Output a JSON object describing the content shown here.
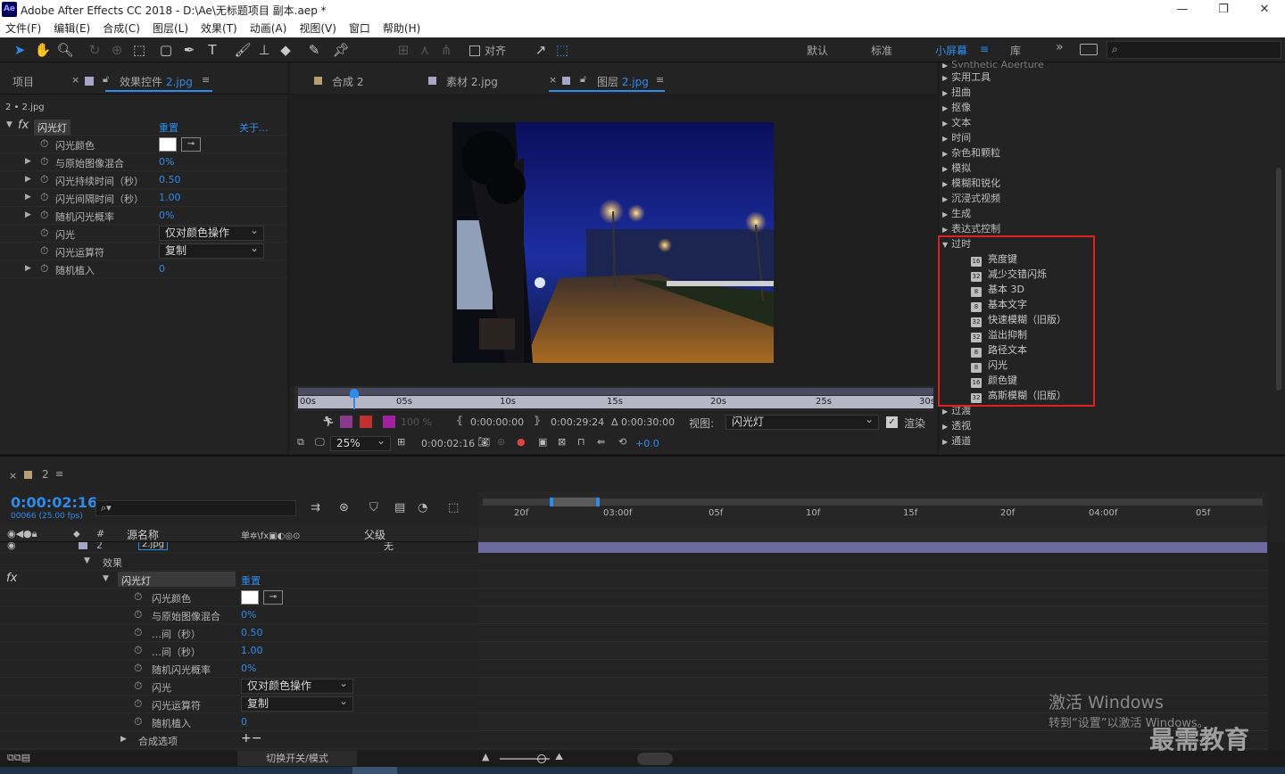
{
  "app": {
    "logo": "Ae",
    "title": "Adobe After Effects CC 2018 - D:\\Ae\\无标题项目 副本.aep *",
    "minimize": "—",
    "maximize": "❐",
    "close": "✕"
  },
  "menu": [
    "文件(F)",
    "编辑(E)",
    "合成(C)",
    "图层(L)",
    "效果(T)",
    "动画(A)",
    "视图(V)",
    "窗口",
    "帮助(H)"
  ],
  "toolbar": {
    "snap_label": "对齐",
    "workspaces": [
      "默认",
      "标准",
      "小屏幕",
      "库"
    ],
    "active_workspace": "小屏幕",
    "more": "»"
  },
  "left_panel": {
    "tab_project": "项目",
    "tab_effects": "效果控件",
    "tab_effects_layer": "2.jpg",
    "breadcrumb": "2 • 2.jpg",
    "effect_name": "闪光灯",
    "reset": "重置",
    "about": "关于...",
    "props": [
      {
        "label": "闪光颜色",
        "value": "",
        "kind": "color"
      },
      {
        "label": "与原始图像混合",
        "value": "0%"
      },
      {
        "label": "闪光持续时间（秒）",
        "value": "0.50"
      },
      {
        "label": "闪光间隔时间（秒）",
        "value": "1.00"
      },
      {
        "label": "随机闪光概率",
        "value": "0%"
      },
      {
        "label": "闪光",
        "value": "仅对颜色操作",
        "kind": "select"
      },
      {
        "label": "闪光运算符",
        "value": "复制",
        "kind": "select"
      },
      {
        "label": "随机植入",
        "value": "0"
      }
    ]
  },
  "viewer": {
    "tabs": [
      {
        "label": "合成",
        "sub": "2"
      },
      {
        "label": "素材",
        "sub": "2.jpg"
      },
      {
        "label": "图层",
        "sub": "2.jpg"
      }
    ],
    "ruler": [
      "00s",
      "05s",
      "10s",
      "15s",
      "20s",
      "25s",
      "30s"
    ],
    "in_time": "0:00:00:00",
    "out_time": "0:00:29:24",
    "duration": "Δ 0:00:30:00",
    "view_label": "视图:",
    "view_value": "闪光灯",
    "render_label": "渲染",
    "zoom_pct": "100 %",
    "zoom": "25%",
    "current_time": "0:00:02:16",
    "exposure": "+0.0"
  },
  "effects_list": {
    "top_partial": "Synthetic Aperture",
    "categories": [
      "实用工具",
      "扭曲",
      "抠像",
      "文本",
      "时间",
      "杂色和颗粒",
      "模拟",
      "模糊和锐化",
      "沉浸式视频",
      "生成",
      "表达式控制"
    ],
    "expanded": "过时",
    "expanded_items": [
      {
        "bit": "16",
        "label": "亮度键"
      },
      {
        "bit": "32",
        "label": "减少交错闪烁"
      },
      {
        "bit": "8",
        "label": "基本 3D"
      },
      {
        "bit": "8",
        "label": "基本文字"
      },
      {
        "bit": "32",
        "label": "快速模糊（旧版）"
      },
      {
        "bit": "32",
        "label": "溢出抑制"
      },
      {
        "bit": "8",
        "label": "路径文本"
      },
      {
        "bit": "8",
        "label": "闪光"
      },
      {
        "bit": "16",
        "label": "颜色键"
      },
      {
        "bit": "32",
        "label": "高斯模糊（旧版）"
      }
    ],
    "after": [
      "过渡",
      "透视",
      "通道"
    ],
    "highlight_color": "#e02020"
  },
  "timeline": {
    "comp_tab": "2",
    "timecode": "0:00:02:16",
    "fps": "00066 (25.00 fps)",
    "search_placeholder": "",
    "col_source": "源名称",
    "col_parent": "父级",
    "col_switches": "单✲\\fx▣◐◎⊙",
    "layer_num": "2",
    "layer_name": "2.jpg",
    "parent_value": "无",
    "effects_group": "效果",
    "effect_name": "闪光灯",
    "reset": "重置",
    "props": [
      {
        "label": "闪光颜色",
        "value": "",
        "kind": "color"
      },
      {
        "label": "与原始图像混合",
        "value": "0%"
      },
      {
        "label": "…间（秒）",
        "value": "0.50"
      },
      {
        "label": "…间（秒）",
        "value": "1.00"
      },
      {
        "label": "随机闪光概率",
        "value": "0%"
      },
      {
        "label": "闪光",
        "value": "仅对颜色操作",
        "kind": "select"
      },
      {
        "label": "闪光运算符",
        "value": "复制",
        "kind": "select"
      },
      {
        "label": "随机植入",
        "value": "0"
      }
    ],
    "comp_options": "合成选项",
    "comp_options_btns": "+−",
    "ruler": [
      "20f",
      "03:00f",
      "05f",
      "10f",
      "15f",
      "20f",
      "04:00f",
      "05f"
    ],
    "toggle_label": "切换开关/模式"
  },
  "watermark": {
    "line1": "激活 Windows",
    "line2": "转到“设置”以激活 Windows。",
    "brand": "最需教育"
  }
}
